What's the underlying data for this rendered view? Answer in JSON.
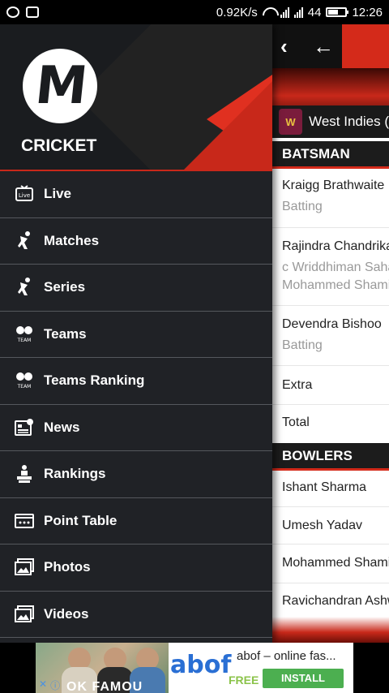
{
  "status_bar": {
    "speed": "0.92K/s",
    "network": "44",
    "time": "12:26"
  },
  "background_app": {
    "team": "West Indies (",
    "team_flag_text": "W",
    "batsman_header": "BATSMAN",
    "batsmen": [
      {
        "name": "Kraigg Brathwaite",
        "status": "Batting"
      },
      {
        "name": "Rajindra Chandrika",
        "status": "c Wriddhiman Saha",
        "status2": "Mohammed Shami"
      },
      {
        "name": "Devendra Bishoo",
        "status": "Batting"
      }
    ],
    "extra": "Extra",
    "total": "Total",
    "bowlers_header": "BOWLERS",
    "bowlers": [
      "Ishant Sharma",
      "Umesh Yadav",
      "Mohammed Shami",
      "Ravichandran Ashwi"
    ]
  },
  "drawer": {
    "logo_letter": "M",
    "app_name": "CRICKET",
    "items": [
      {
        "label": "Live",
        "icon": "tv-icon"
      },
      {
        "label": "Matches",
        "icon": "bowler-icon"
      },
      {
        "label": "Series",
        "icon": "bowler-icon"
      },
      {
        "label": "Teams",
        "icon": "team-icon"
      },
      {
        "label": "Teams Ranking",
        "icon": "team-icon"
      },
      {
        "label": "News",
        "icon": "news-icon"
      },
      {
        "label": "Rankings",
        "icon": "podium-icon"
      },
      {
        "label": "Point Table",
        "icon": "table-icon"
      },
      {
        "label": "Photos",
        "icon": "photos-icon"
      },
      {
        "label": "Videos",
        "icon": "videos-icon"
      }
    ]
  },
  "ad": {
    "brand": "abof",
    "title": "abof – online fas...",
    "free": "FREE",
    "install": "INSTALL",
    "overlay": "OK FAMOU"
  },
  "colors": {
    "accent": "#d42a1a",
    "drawer_bg": "#202226",
    "install_green": "#4caf50"
  }
}
